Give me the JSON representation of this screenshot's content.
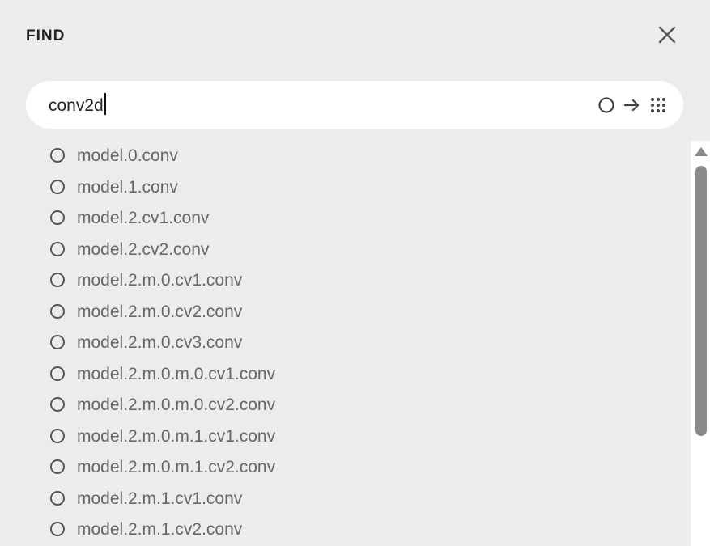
{
  "panel": {
    "title": "FIND",
    "close_icon": "close-icon"
  },
  "search": {
    "value": "conv2d",
    "icons": [
      "circle-option-icon",
      "arrow-right-icon",
      "grid-dots-icon"
    ]
  },
  "results": {
    "items": [
      {
        "label": "model.0.conv"
      },
      {
        "label": "model.1.conv"
      },
      {
        "label": "model.2.cv1.conv"
      },
      {
        "label": "model.2.cv2.conv"
      },
      {
        "label": "model.2.m.0.cv1.conv"
      },
      {
        "label": "model.2.m.0.cv2.conv"
      },
      {
        "label": "model.2.m.0.cv3.conv"
      },
      {
        "label": "model.2.m.0.m.0.cv1.conv"
      },
      {
        "label": "model.2.m.0.m.0.cv2.conv"
      },
      {
        "label": "model.2.m.0.m.1.cv1.conv"
      },
      {
        "label": "model.2.m.0.m.1.cv2.conv"
      },
      {
        "label": "model.2.m.1.cv1.conv"
      },
      {
        "label": "model.2.m.1.cv2.conv"
      }
    ]
  },
  "colors": {
    "background": "#ececec",
    "input_background": "#ffffff",
    "item_text": "#666666",
    "scroll_thumb": "#8a8a8a"
  }
}
